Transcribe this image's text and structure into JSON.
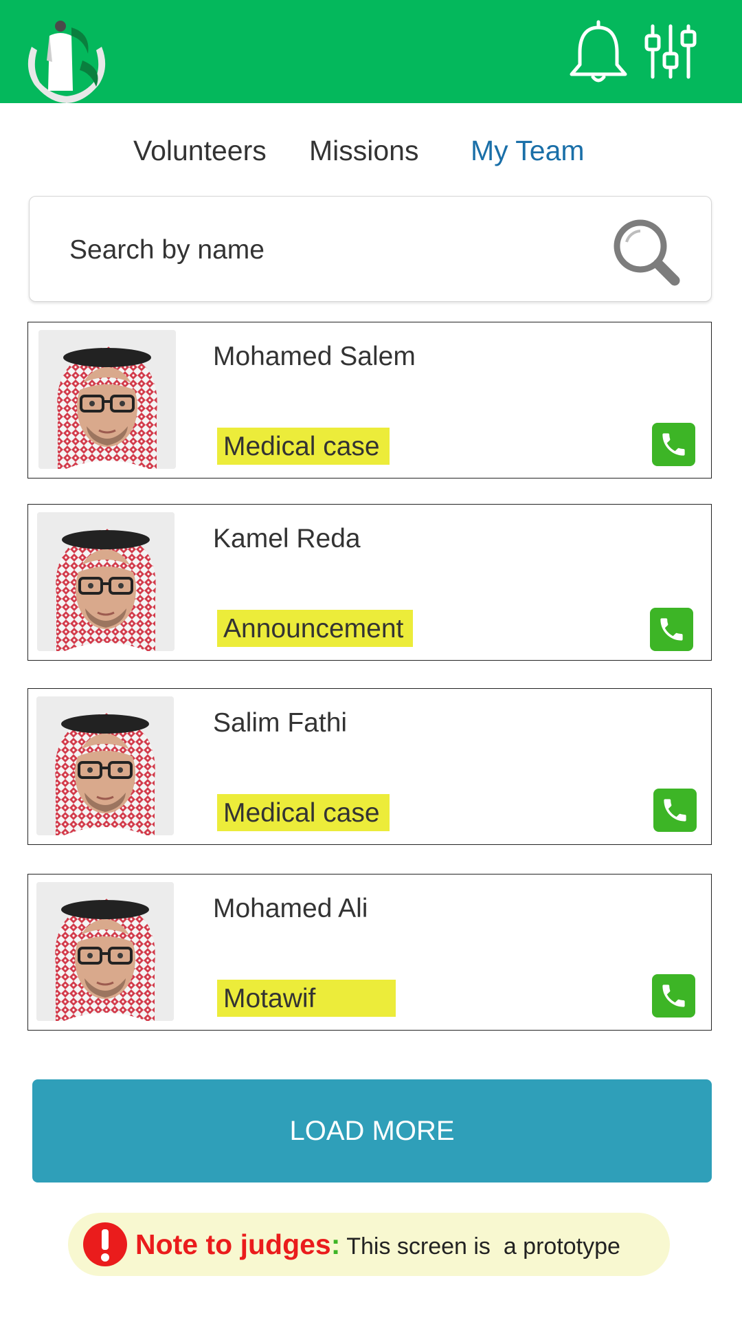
{
  "header": {
    "bg_color": "#04b85c",
    "logo_icon": "hands-holding-pilgrim-logo",
    "notification_icon": "bell-icon",
    "filter_icon": "sliders-icon"
  },
  "tabs": [
    {
      "label": "Volunteers",
      "active": false
    },
    {
      "label": "Missions",
      "active": false
    },
    {
      "label": "My Team",
      "active": true
    }
  ],
  "search": {
    "placeholder": "Search by name",
    "icon": "search-icon"
  },
  "team": [
    {
      "name": "Mohamed Salem",
      "tag": "Medical case"
    },
    {
      "name": "Kamel Reda",
      "tag": "Announcement"
    },
    {
      "name": "Salim Fathi",
      "tag": "Medical case"
    },
    {
      "name": "Mohamed Ali",
      "tag": "Motawif"
    }
  ],
  "load_more": {
    "label": "LOAD MORE",
    "color": "#2f9fb9"
  },
  "note": {
    "label": "Note to judges",
    "colon": ":",
    "text": " This screen is  a prototype"
  },
  "colors": {
    "tag_bg": "#ecec3a",
    "call_bg": "#3db526",
    "active_tab": "#1a6fa8",
    "note_bg": "#f8f8d0",
    "note_label": "#ea1c1c"
  }
}
